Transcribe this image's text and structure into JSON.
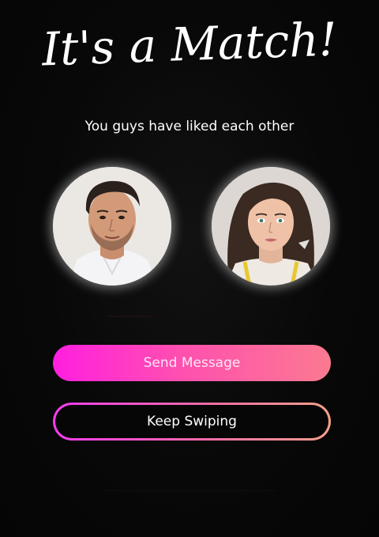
{
  "header": {
    "title": "It's a Match!",
    "subtitle": "You guys have liked each other"
  },
  "profiles": [
    {
      "role": "you",
      "photo_icon": "man-avatar"
    },
    {
      "role": "match",
      "photo_icon": "woman-avatar"
    }
  ],
  "actions": {
    "send_message_label": "Send Message",
    "keep_swiping_label": "Keep Swiping"
  },
  "colors": {
    "background": "#070707",
    "primary_gradient_start": "#ff1fe0",
    "primary_gradient_end": "#fb7a90",
    "text": "#ffffff"
  }
}
